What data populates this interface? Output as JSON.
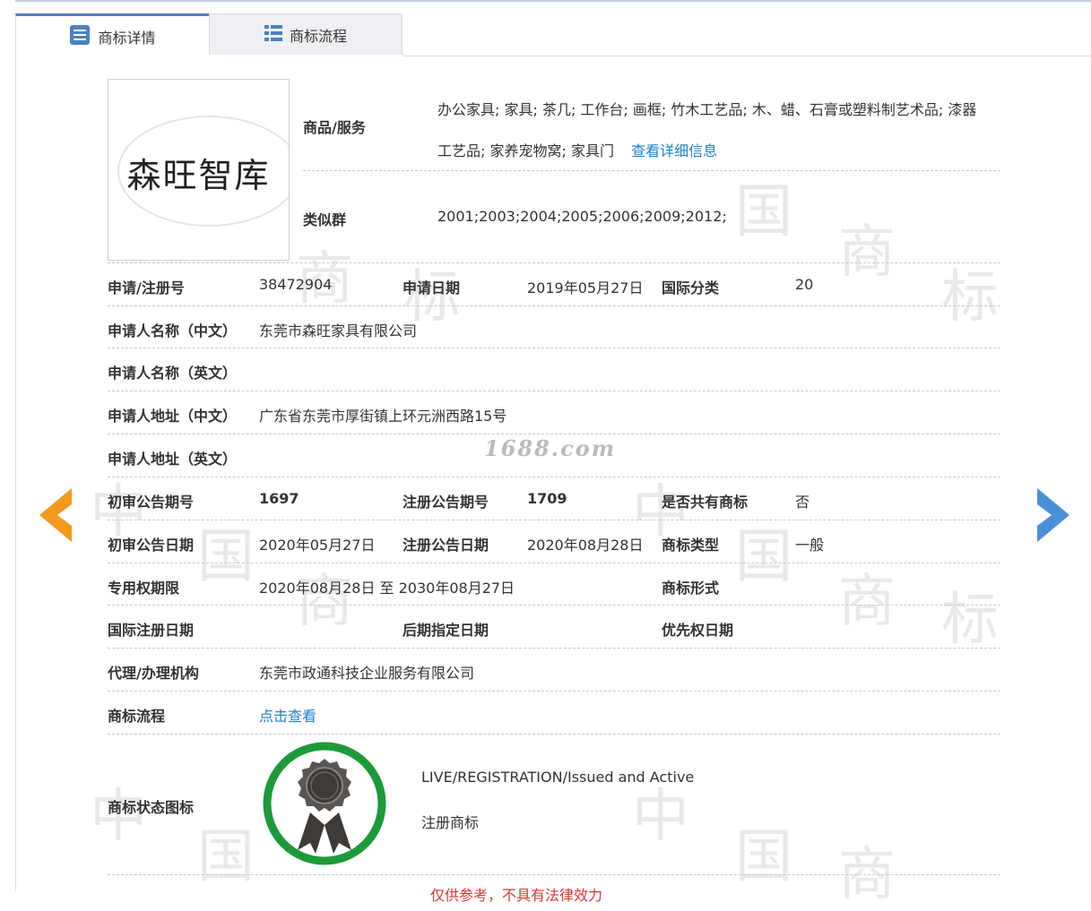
{
  "tabs": {
    "details_label": "商标详情",
    "process_label": "商标流程"
  },
  "trademark": {
    "logo_text": "森旺智库",
    "goods_label": "商品/服务",
    "goods_line1": "办公家具; 家具; 茶几; 工作台; 画框; 竹木工艺品; 木、蜡、石膏或塑料制艺术品; 漆器",
    "goods_line2": "工艺品; 家养宠物窝; 家具门",
    "goods_detail_link": "查看详细信息",
    "similar_label": "类似群",
    "similar_value": "2001;2003;2004;2005;2006;2009;2012;"
  },
  "fields": {
    "reg_no_label": "申请/注册号",
    "reg_no": "38472904",
    "apply_date_label": "申请日期",
    "apply_date": "2019年05月27日",
    "intl_class_label": "国际分类",
    "intl_class": "20",
    "applicant_cn_label": "申请人名称（中文）",
    "applicant_cn": "东莞市森旺家具有限公司",
    "applicant_en_label": "申请人名称（英文）",
    "applicant_en": "",
    "address_cn_label": "申请人地址（中文）",
    "address_cn": "广东省东莞市厚街镇上环元洲西路15号",
    "address_en_label": "申请人地址（英文）",
    "address_en": "",
    "prelim_no_label": "初审公告期号",
    "prelim_no": "1697",
    "reg_pub_no_label": "注册公告期号",
    "reg_pub_no": "1709",
    "shared_label": "是否共有商标",
    "shared": "否",
    "prelim_date_label": "初审公告日期",
    "prelim_date": "2020年05月27日",
    "reg_pub_date_label": "注册公告日期",
    "reg_pub_date": "2020年08月28日",
    "type_label": "商标类型",
    "type": "一般",
    "term_label": "专用权期限",
    "term": "2020年08月28日 至 2030年08月27日",
    "form_label": "商标形式",
    "form": "",
    "intl_reg_date_label": "国际注册日期",
    "later_date_label": "后期指定日期",
    "priority_date_label": "优先权日期",
    "agent_label": "代理/办理机构",
    "agent": "东莞市政通科技企业服务有限公司",
    "process_label": "商标流程",
    "process_link": "点击查看",
    "status_icon_label": "商标状态图标",
    "status_en": "LIVE/REGISTRATION/Issued and Active",
    "status_cn": "注册商标"
  },
  "watermark": {
    "site": "1688.com",
    "glyphs": [
      "中",
      "国",
      "商",
      "标"
    ]
  },
  "bottom_notice": "仅供参考，不具有法律效力",
  "colors": {
    "link": "#1e7fc8",
    "arrow_left": "#f39a1e",
    "arrow_right": "#4a90d9",
    "badge_ring": "#1d9a3a",
    "tab_accent": "#4f7fbf"
  },
  "icons": {
    "details_tab": "document-list-icon",
    "process_tab": "list-icon",
    "prev": "arrow-left-icon",
    "next": "arrow-right-icon",
    "status": "award-ribbon-icon"
  }
}
